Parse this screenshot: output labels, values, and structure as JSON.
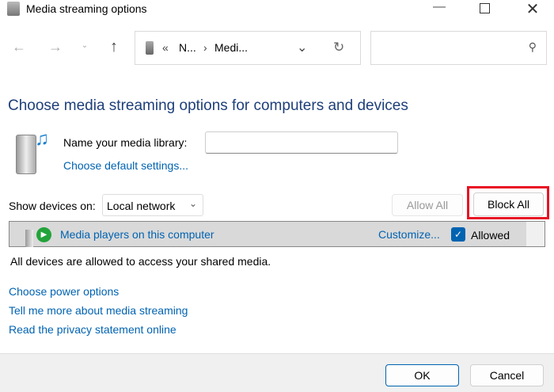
{
  "window": {
    "title": "Media streaming options",
    "minimize_icon": "minimize-icon",
    "maximize_icon": "maximize-icon",
    "close_icon": "close-icon"
  },
  "nav": {
    "breadcrumb": [
      "N...",
      "Medi..."
    ],
    "overflow": "«",
    "search_placeholder": ""
  },
  "main": {
    "heading": "Choose media streaming options for computers and devices",
    "library_label": "Name your media library:",
    "library_value": "",
    "default_settings_link": "Choose default settings...",
    "show_devices_label": "Show devices on:",
    "show_devices_value": "Local network",
    "allow_all": "Allow All",
    "block_all": "Block All",
    "device": {
      "name": "Media players on this computer",
      "customize": "Customize...",
      "allowed_label": "Allowed",
      "allowed": true
    },
    "status": "All devices are allowed to access your shared media.",
    "links": [
      "Choose power options",
      "Tell me more about media streaming",
      "Read the privacy statement online"
    ]
  },
  "footer": {
    "ok": "OK",
    "cancel": "Cancel"
  },
  "colors": {
    "accent": "#0063b1",
    "highlight": "#e81123",
    "heading": "#1e3f7a"
  }
}
